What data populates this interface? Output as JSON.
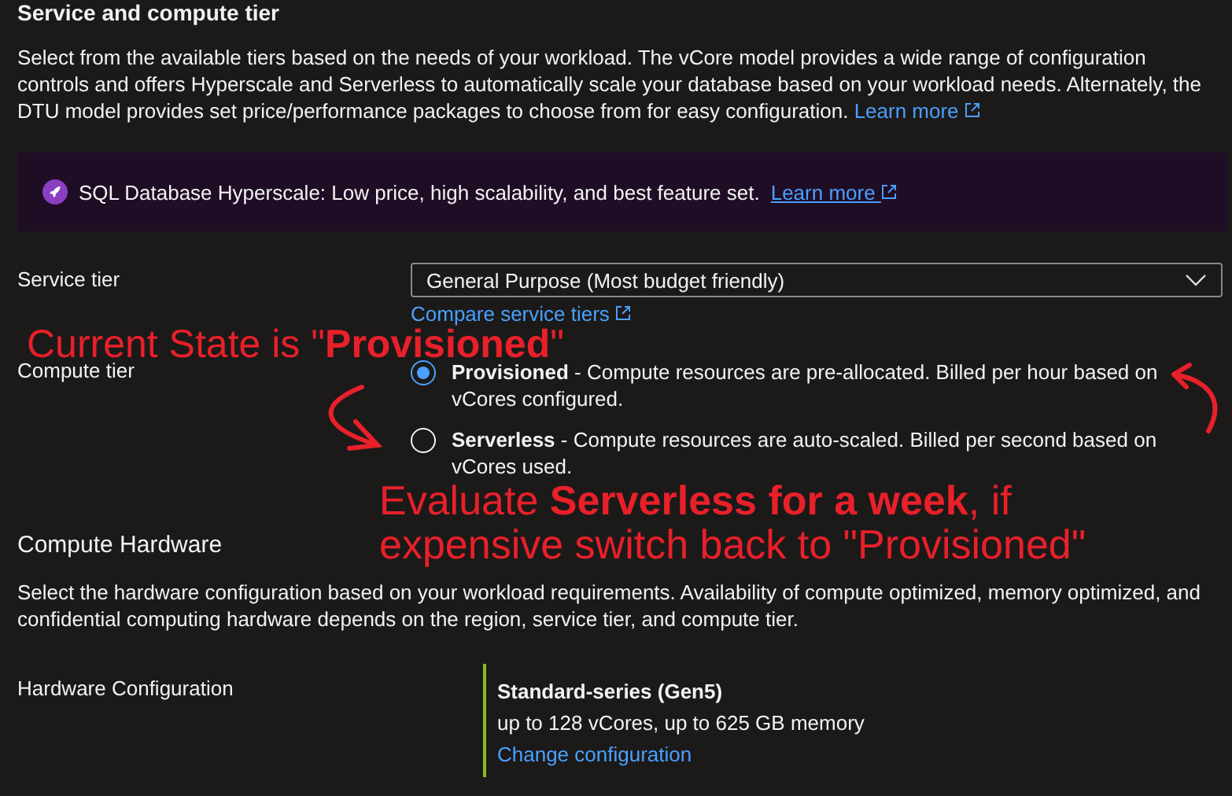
{
  "section": {
    "title": "Service and compute tier",
    "description": "Select from the available tiers based on the needs of your workload. The vCore model provides a wide range of configuration controls and offers Hyperscale and Serverless to automatically scale your database based on your workload needs. Alternately, the DTU model provides set price/performance packages to choose from for easy configuration.",
    "learn_more": "Learn more"
  },
  "banner": {
    "text": "SQL Database Hyperscale: Low price, high scalability, and best feature set.",
    "learn_more": "Learn more"
  },
  "service_tier": {
    "label": "Service tier",
    "value": "General Purpose (Most budget friendly)",
    "link": "Compare service tiers"
  },
  "compute_tier": {
    "label": "Compute tier",
    "options": [
      {
        "name": "Provisioned",
        "description": "- Compute resources are pre-allocated. Billed per hour based on vCores configured.",
        "selected": true
      },
      {
        "name": "Serverless",
        "description": "- Compute resources are auto-scaled. Billed per second based on vCores used.",
        "selected": false
      }
    ]
  },
  "compute_hardware": {
    "title": "Compute Hardware",
    "description": "Select the hardware configuration based on your workload requirements. Availability of compute optimized, memory optimized, and confidential computing hardware depends on the region, service tier, and compute tier.",
    "label": "Hardware Configuration",
    "config_name": "Standard-series (Gen5)",
    "config_detail": "up to 128 vCores, up to 625 GB memory",
    "change_link": "Change configuration"
  },
  "annotations": [
    "Current State is \"**Provisioned**\"",
    "Evaluate **Serverless for a week**, if expensive switch back to \"Provisioned\""
  ]
}
